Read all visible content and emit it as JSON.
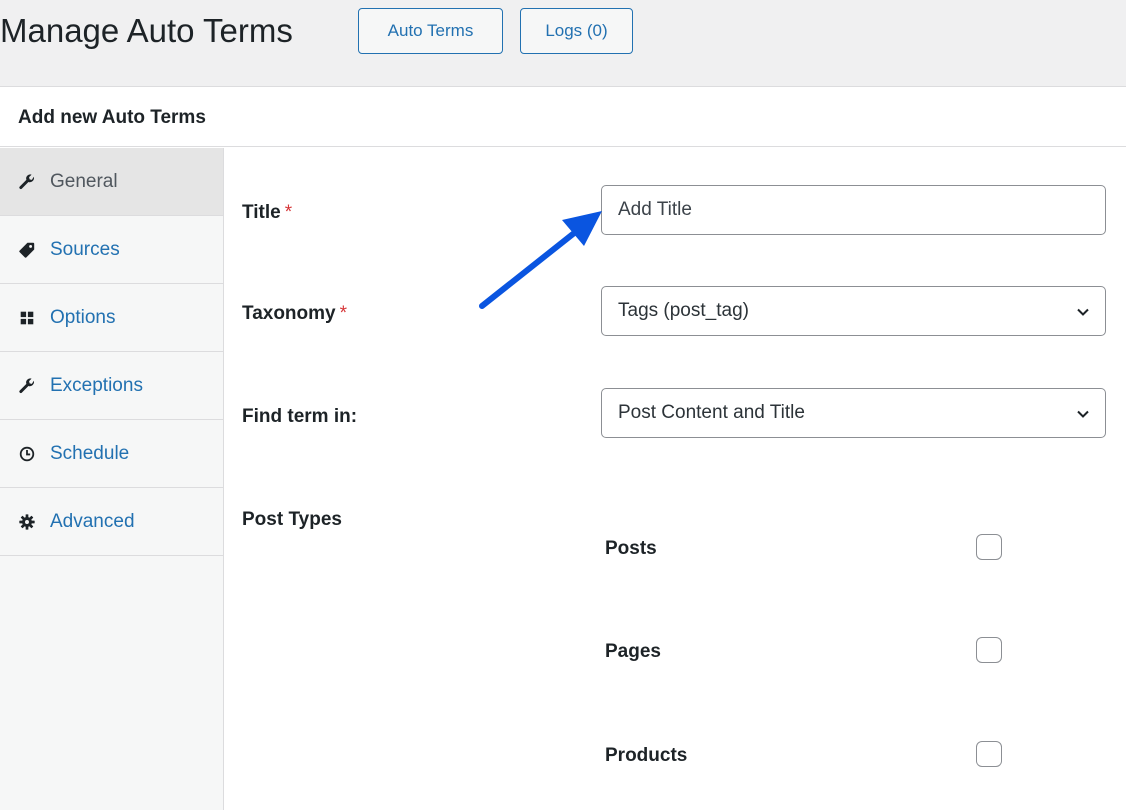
{
  "header": {
    "title": "Manage Auto Terms",
    "buttons": {
      "auto_terms": "Auto Terms",
      "logs": "Logs (0)"
    }
  },
  "panel": {
    "title": "Add new Auto Terms"
  },
  "sidebar": {
    "tabs": [
      {
        "label": "General",
        "icon": "wrench-icon",
        "active": true
      },
      {
        "label": "Sources",
        "icon": "tag-icon",
        "active": false
      },
      {
        "label": "Options",
        "icon": "grid-icon",
        "active": false
      },
      {
        "label": "Exceptions",
        "icon": "wrench-icon",
        "active": false
      },
      {
        "label": "Schedule",
        "icon": "clock-icon",
        "active": false
      },
      {
        "label": "Advanced",
        "icon": "gear-icon",
        "active": false
      }
    ]
  },
  "form": {
    "title": {
      "label": "Title",
      "required_mark": "*",
      "placeholder": "Add Title",
      "value": ""
    },
    "taxonomy": {
      "label": "Taxonomy",
      "required_mark": "*",
      "selected": "Tags (post_tag)"
    },
    "find_term": {
      "label": "Find term in:",
      "selected": "Post Content and Title"
    },
    "post_types": {
      "label": "Post Types",
      "items": [
        {
          "label": "Posts",
          "checked": false
        },
        {
          "label": "Pages",
          "checked": false
        },
        {
          "label": "Products",
          "checked": false
        }
      ]
    }
  },
  "colors": {
    "accent": "#2271b1",
    "required": "#d63638",
    "annotation_arrow": "#0a55e0"
  }
}
